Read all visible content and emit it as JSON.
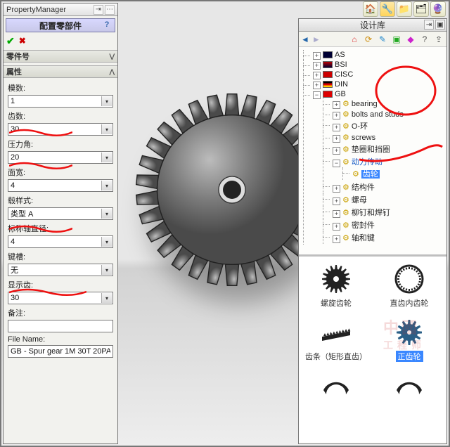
{
  "pm": {
    "header": "PropertyManager",
    "title": "配置零部件",
    "part_hdr": "零件号",
    "attr_hdr": "属性",
    "fields": {
      "modulus": {
        "label": "模数:",
        "value": "1"
      },
      "teeth": {
        "label": "齿数:",
        "value": "30"
      },
      "pressure": {
        "label": "压力角:",
        "value": "20"
      },
      "width": {
        "label": "面宽:",
        "value": "4"
      },
      "hubStyle": {
        "label": "毂样式:",
        "value": "类型 A"
      },
      "nomDia": {
        "label": "标称轴直径:",
        "value": "4"
      },
      "keyway": {
        "label": "键槽:",
        "value": "无"
      },
      "showTooth": {
        "label": "显示齿:",
        "value": "30"
      },
      "remark": {
        "label": "备注:",
        "value": ""
      },
      "filename": {
        "label": "File Name:",
        "value": "GB - Spur gear 1M 30T 20PA"
      }
    }
  },
  "lib": {
    "title": "设计库",
    "tree": {
      "top": [
        {
          "id": "as",
          "label": "AS",
          "flag": "flag-as"
        },
        {
          "id": "bsi",
          "label": "BSI",
          "flag": "flag-bsi"
        },
        {
          "id": "cisc",
          "label": "CISC",
          "flag": "flag-cisc"
        },
        {
          "id": "din",
          "label": "DIN",
          "flag": "flag-din"
        }
      ],
      "gb": "GB",
      "gbChildren": [
        "bearing",
        "bolts and studs",
        "O-环",
        "screws",
        "垫圈和挡圈"
      ],
      "power": "动力传动",
      "gears": "齿轮",
      "rest": [
        "结构件",
        "螺母",
        "柳钉和焊钉",
        "密封件",
        "轴和键"
      ]
    },
    "thumbs": {
      "t1": "螺旋齿轮",
      "t2": "直齿内齿轮",
      "t3": "齿条（矩形直齿）",
      "t4": "正齿轮"
    }
  }
}
